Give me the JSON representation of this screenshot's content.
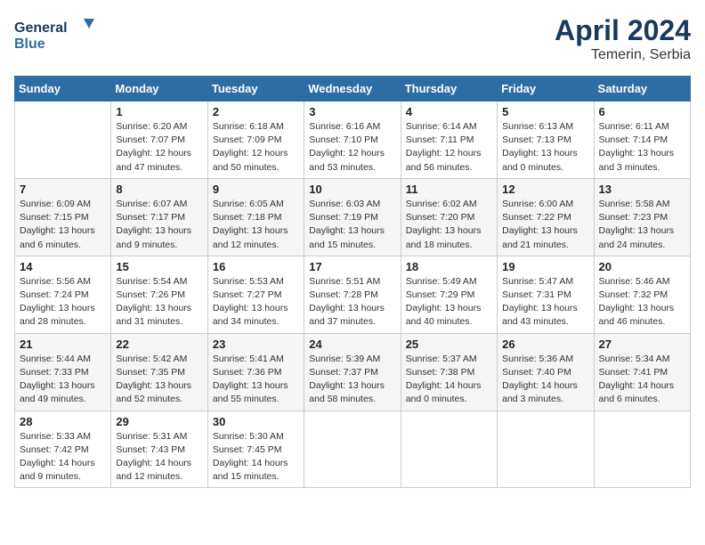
{
  "header": {
    "logo_line1": "General",
    "logo_line2": "Blue",
    "month": "April 2024",
    "location": "Temerin, Serbia"
  },
  "weekdays": [
    "Sunday",
    "Monday",
    "Tuesday",
    "Wednesday",
    "Thursday",
    "Friday",
    "Saturday"
  ],
  "weeks": [
    [
      {
        "day": "",
        "info": ""
      },
      {
        "day": "1",
        "info": "Sunrise: 6:20 AM\nSunset: 7:07 PM\nDaylight: 12 hours\nand 47 minutes."
      },
      {
        "day": "2",
        "info": "Sunrise: 6:18 AM\nSunset: 7:09 PM\nDaylight: 12 hours\nand 50 minutes."
      },
      {
        "day": "3",
        "info": "Sunrise: 6:16 AM\nSunset: 7:10 PM\nDaylight: 12 hours\nand 53 minutes."
      },
      {
        "day": "4",
        "info": "Sunrise: 6:14 AM\nSunset: 7:11 PM\nDaylight: 12 hours\nand 56 minutes."
      },
      {
        "day": "5",
        "info": "Sunrise: 6:13 AM\nSunset: 7:13 PM\nDaylight: 13 hours\nand 0 minutes."
      },
      {
        "day": "6",
        "info": "Sunrise: 6:11 AM\nSunset: 7:14 PM\nDaylight: 13 hours\nand 3 minutes."
      }
    ],
    [
      {
        "day": "7",
        "info": "Sunrise: 6:09 AM\nSunset: 7:15 PM\nDaylight: 13 hours\nand 6 minutes."
      },
      {
        "day": "8",
        "info": "Sunrise: 6:07 AM\nSunset: 7:17 PM\nDaylight: 13 hours\nand 9 minutes."
      },
      {
        "day": "9",
        "info": "Sunrise: 6:05 AM\nSunset: 7:18 PM\nDaylight: 13 hours\nand 12 minutes."
      },
      {
        "day": "10",
        "info": "Sunrise: 6:03 AM\nSunset: 7:19 PM\nDaylight: 13 hours\nand 15 minutes."
      },
      {
        "day": "11",
        "info": "Sunrise: 6:02 AM\nSunset: 7:20 PM\nDaylight: 13 hours\nand 18 minutes."
      },
      {
        "day": "12",
        "info": "Sunrise: 6:00 AM\nSunset: 7:22 PM\nDaylight: 13 hours\nand 21 minutes."
      },
      {
        "day": "13",
        "info": "Sunrise: 5:58 AM\nSunset: 7:23 PM\nDaylight: 13 hours\nand 24 minutes."
      }
    ],
    [
      {
        "day": "14",
        "info": "Sunrise: 5:56 AM\nSunset: 7:24 PM\nDaylight: 13 hours\nand 28 minutes."
      },
      {
        "day": "15",
        "info": "Sunrise: 5:54 AM\nSunset: 7:26 PM\nDaylight: 13 hours\nand 31 minutes."
      },
      {
        "day": "16",
        "info": "Sunrise: 5:53 AM\nSunset: 7:27 PM\nDaylight: 13 hours\nand 34 minutes."
      },
      {
        "day": "17",
        "info": "Sunrise: 5:51 AM\nSunset: 7:28 PM\nDaylight: 13 hours\nand 37 minutes."
      },
      {
        "day": "18",
        "info": "Sunrise: 5:49 AM\nSunset: 7:29 PM\nDaylight: 13 hours\nand 40 minutes."
      },
      {
        "day": "19",
        "info": "Sunrise: 5:47 AM\nSunset: 7:31 PM\nDaylight: 13 hours\nand 43 minutes."
      },
      {
        "day": "20",
        "info": "Sunrise: 5:46 AM\nSunset: 7:32 PM\nDaylight: 13 hours\nand 46 minutes."
      }
    ],
    [
      {
        "day": "21",
        "info": "Sunrise: 5:44 AM\nSunset: 7:33 PM\nDaylight: 13 hours\nand 49 minutes."
      },
      {
        "day": "22",
        "info": "Sunrise: 5:42 AM\nSunset: 7:35 PM\nDaylight: 13 hours\nand 52 minutes."
      },
      {
        "day": "23",
        "info": "Sunrise: 5:41 AM\nSunset: 7:36 PM\nDaylight: 13 hours\nand 55 minutes."
      },
      {
        "day": "24",
        "info": "Sunrise: 5:39 AM\nSunset: 7:37 PM\nDaylight: 13 hours\nand 58 minutes."
      },
      {
        "day": "25",
        "info": "Sunrise: 5:37 AM\nSunset: 7:38 PM\nDaylight: 14 hours\nand 0 minutes."
      },
      {
        "day": "26",
        "info": "Sunrise: 5:36 AM\nSunset: 7:40 PM\nDaylight: 14 hours\nand 3 minutes."
      },
      {
        "day": "27",
        "info": "Sunrise: 5:34 AM\nSunset: 7:41 PM\nDaylight: 14 hours\nand 6 minutes."
      }
    ],
    [
      {
        "day": "28",
        "info": "Sunrise: 5:33 AM\nSunset: 7:42 PM\nDaylight: 14 hours\nand 9 minutes."
      },
      {
        "day": "29",
        "info": "Sunrise: 5:31 AM\nSunset: 7:43 PM\nDaylight: 14 hours\nand 12 minutes."
      },
      {
        "day": "30",
        "info": "Sunrise: 5:30 AM\nSunset: 7:45 PM\nDaylight: 14 hours\nand 15 minutes."
      },
      {
        "day": "",
        "info": ""
      },
      {
        "day": "",
        "info": ""
      },
      {
        "day": "",
        "info": ""
      },
      {
        "day": "",
        "info": ""
      }
    ]
  ]
}
